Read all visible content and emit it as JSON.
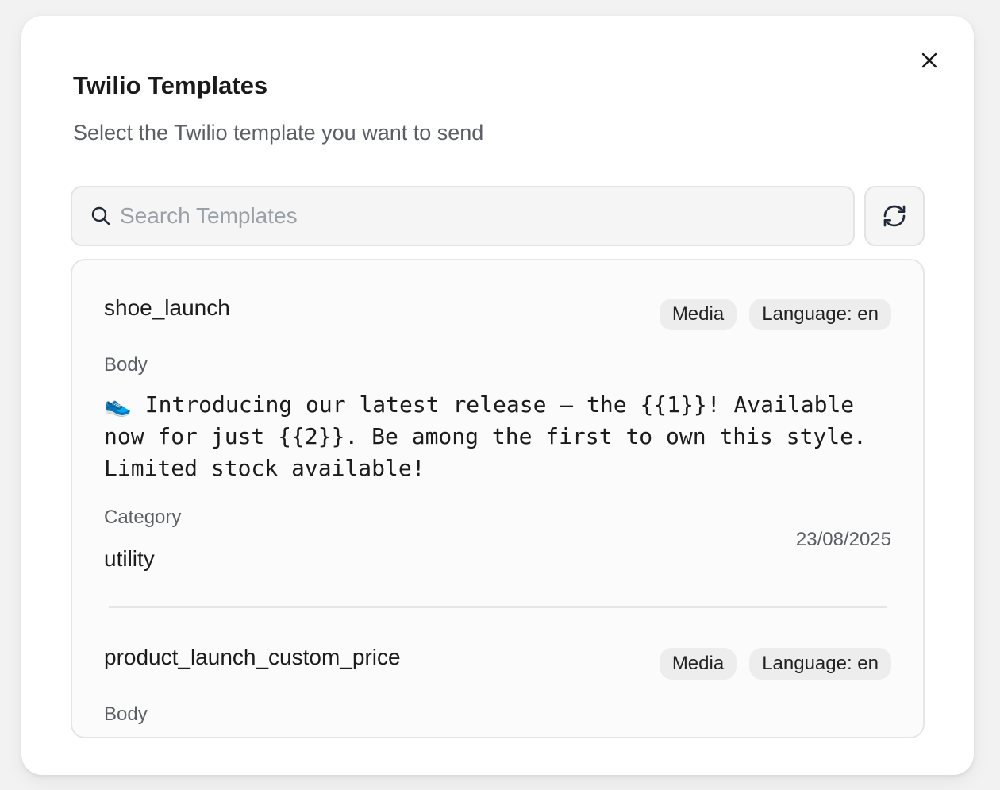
{
  "dialog": {
    "title": "Twilio Templates",
    "subtitle": "Select the Twilio template you want to send",
    "close_icon": "close-icon"
  },
  "search": {
    "placeholder": "Search Templates",
    "value": "",
    "icon": "search-icon"
  },
  "refresh": {
    "icon": "refresh-icon"
  },
  "templates": [
    {
      "name": "shoe_launch",
      "tags": [
        "Media",
        "Language: en"
      ],
      "body_label": "Body",
      "body": "👟 Introducing our latest release – the {{1}}! Available now for just {{2}}. Be among the first to own this style. Limited stock available!",
      "category_label": "Category",
      "category": "utility",
      "date": "23/08/2025"
    },
    {
      "name": "product_launch_custom_price",
      "tags": [
        "Media",
        "Language: en"
      ],
      "body_label": "Body"
    }
  ]
}
